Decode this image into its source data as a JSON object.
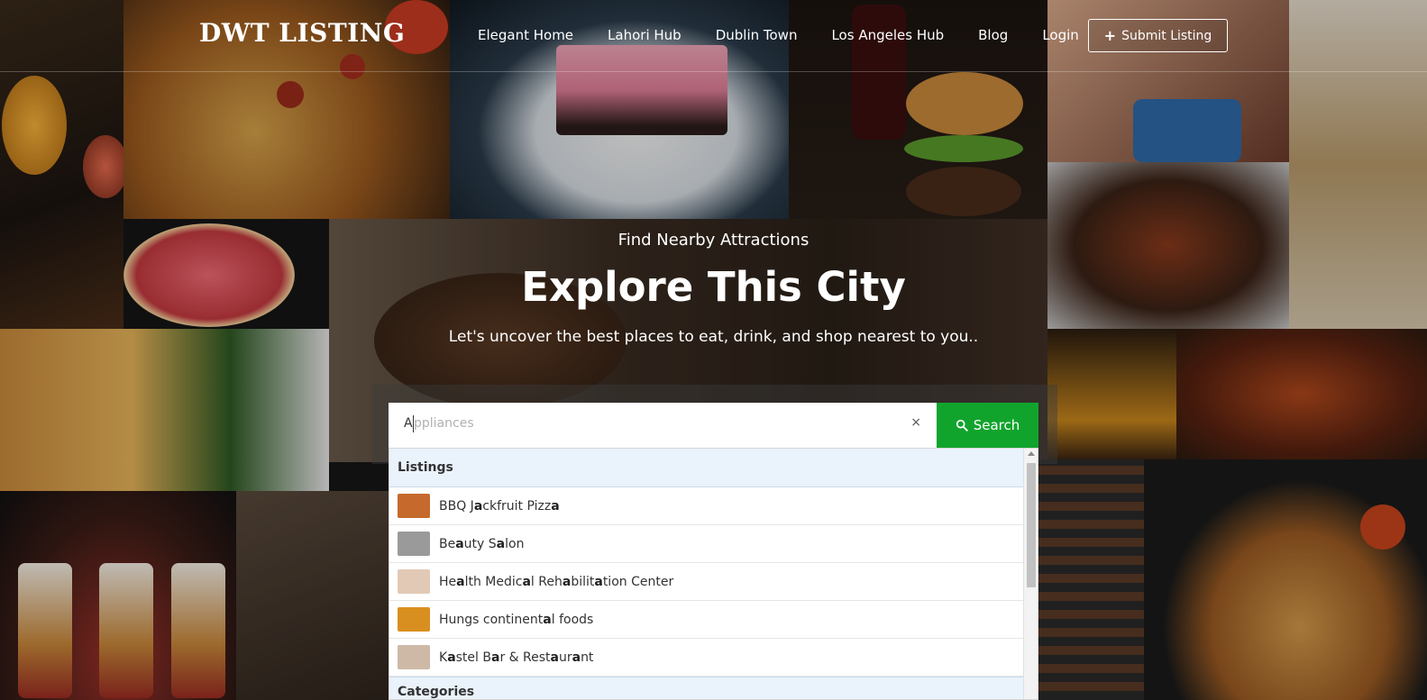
{
  "header": {
    "logo": "DWT LISTING",
    "nav": [
      "Elegant Home",
      "Lahori Hub",
      "Dublin Town",
      "Los Angeles Hub",
      "Blog",
      "Login"
    ],
    "submit_label": "Submit Listing"
  },
  "hero": {
    "kicker": "Find Nearby Attractions",
    "title": "Explore This City",
    "subtitle": "Let's uncover the best places to eat, drink, and shop nearest to you.."
  },
  "search": {
    "typed_value": "A",
    "placeholder_rest": "ppliances",
    "clear_glyph": "×",
    "button_label": "Search"
  },
  "dropdown": {
    "listings_heading": "Listings",
    "categories_heading": "Categories",
    "items": [
      {
        "parts": [
          [
            "BBQ J",
            false
          ],
          [
            "a",
            true
          ],
          [
            "ckfruit Pizz",
            false
          ],
          [
            "a",
            true
          ]
        ],
        "thumb": "#c56a2c"
      },
      {
        "parts": [
          [
            "Be",
            false
          ],
          [
            "a",
            true
          ],
          [
            "uty S",
            false
          ],
          [
            "a",
            true
          ],
          [
            "lon",
            false
          ]
        ],
        "thumb": "#9a9a9a"
      },
      {
        "parts": [
          [
            "He",
            false
          ],
          [
            "a",
            true
          ],
          [
            "lth Medic",
            false
          ],
          [
            "a",
            true
          ],
          [
            "l Reh",
            false
          ],
          [
            "a",
            true
          ],
          [
            "bilit",
            false
          ],
          [
            "a",
            true
          ],
          [
            "tion Center",
            false
          ]
        ],
        "thumb": "#e2c9b6"
      },
      {
        "parts": [
          [
            "Hungs continent",
            false
          ],
          [
            "a",
            true
          ],
          [
            "l foods",
            false
          ]
        ],
        "thumb": "#d98f1f"
      },
      {
        "parts": [
          [
            "K",
            false
          ],
          [
            "a",
            true
          ],
          [
            "stel B",
            false
          ],
          [
            "a",
            true
          ],
          [
            "r & Rest",
            false
          ],
          [
            "a",
            true
          ],
          [
            "ur",
            false
          ],
          [
            "a",
            true
          ],
          [
            "nt",
            false
          ]
        ],
        "thumb": "#cdb9a6"
      }
    ]
  },
  "colors": {
    "search_button": "#11a42c",
    "dropdown_group_bg": "#eaf2fb"
  }
}
